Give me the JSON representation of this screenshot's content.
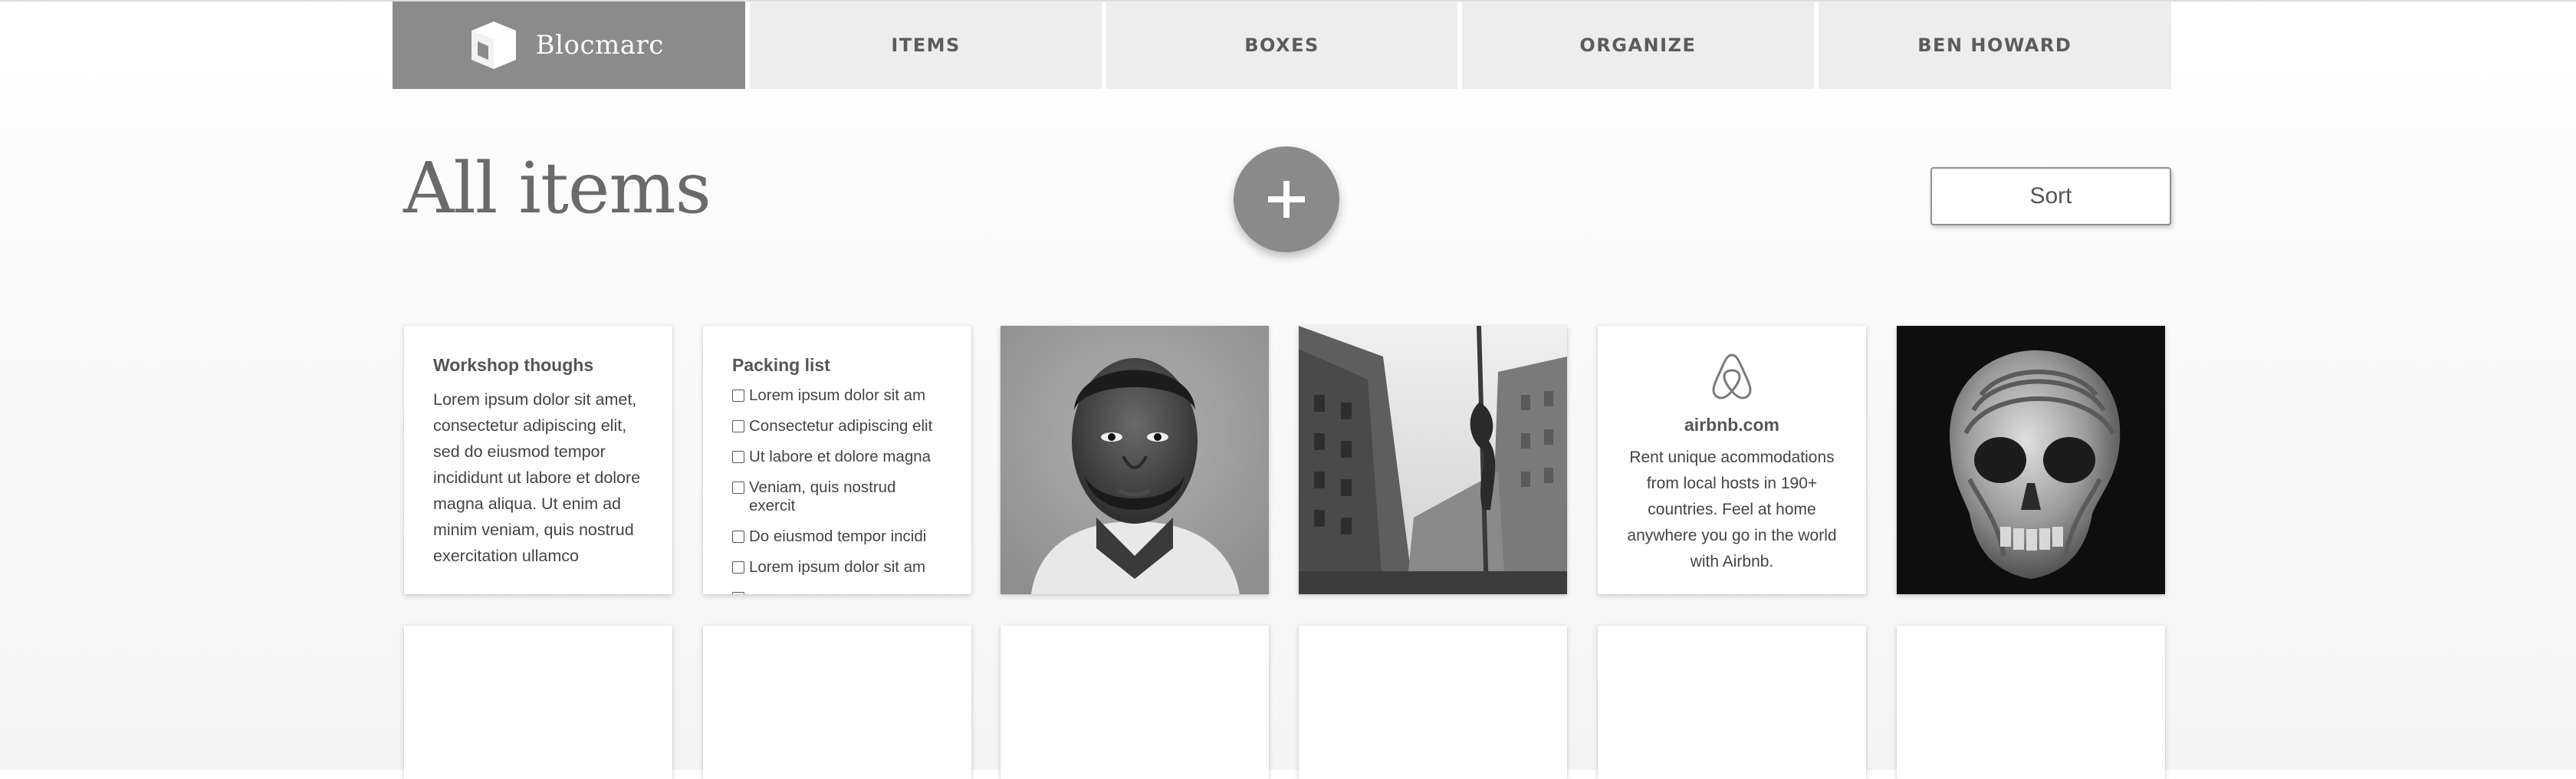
{
  "nav": {
    "logo": {
      "text": "Blocmarc",
      "icon": "cube-icon"
    },
    "items": [
      {
        "label": "ITEMS"
      },
      {
        "label": "BOXES"
      },
      {
        "label": "ORGANIZE"
      },
      {
        "label": "BEN HOWARD"
      }
    ]
  },
  "header": {
    "title": "All items",
    "add_icon": "plus-icon",
    "sort_label": "Sort"
  },
  "cards": {
    "note": {
      "title": "Workshop thoughs",
      "body": "Lorem ipsum dolor sit amet, consectetur adipiscing elit, sed do eiusmod tempor incididunt ut labore et dolore magna aliqua. Ut enim ad minim veniam, quis nostrud exercitation ullamco"
    },
    "checklist": {
      "title": "Packing list",
      "items": [
        "Lorem ipsum dolor sit am",
        "Consectetur adipiscing elit",
        "Ut labore et dolore magna",
        "Veniam, quis nostrud exercit",
        "Do eiusmod tempor incidi",
        "Lorem ipsum dolor sit am"
      ]
    },
    "link": {
      "icon": "airbnb-logo-icon",
      "domain": "airbnb.com",
      "description": "Rent unique acommodations from local hosts in 190+ countries. Feel at home anywhere you go in the world with Airbnb."
    },
    "images": [
      {
        "icon": "portrait-photo"
      },
      {
        "icon": "city-sculpture-photo"
      },
      {
        "icon": "skull-art-photo"
      }
    ]
  }
}
